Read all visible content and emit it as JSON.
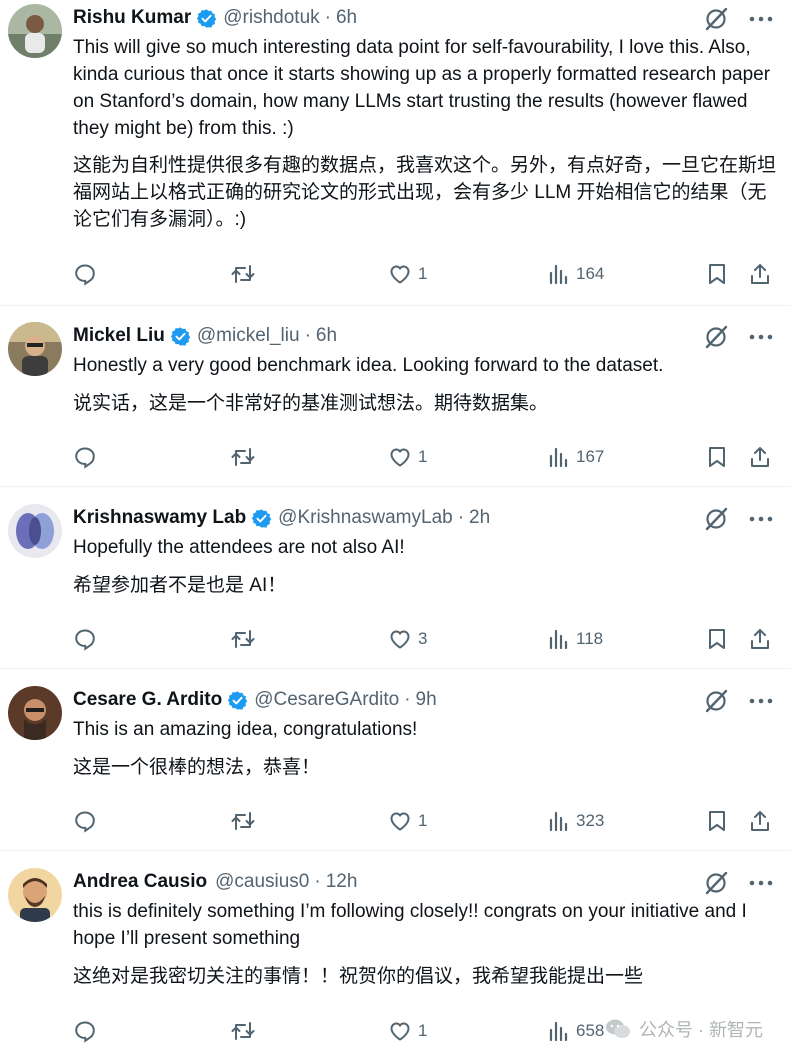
{
  "tweets": [
    {
      "name": "Rishu Kumar",
      "handle": "@rishdotuk",
      "time": "6h",
      "text_en": "This will give so much interesting data point for self-favourability, I love this. Also, kinda curious that once it starts showing up as a properly formatted research paper on Stanford’s domain, how many LLMs start trusting the results (however flawed they might be) from this. :)",
      "text_zh": "这能为自利性提供很多有趣的数据点，我喜欢这个。另外，有点好奇，一旦它在斯坦福网站上以格式正确的研究论文的形式出现，会有多少 LLM 开始相信它的结果（无论它们有多漏洞）。:)",
      "likes": "1",
      "views": "164"
    },
    {
      "name": "Mickel Liu",
      "handle": "@mickel_liu",
      "time": "6h",
      "text_en": "Honestly a very good benchmark idea. Looking forward to the dataset.",
      "text_zh": "说实话，这是一个非常好的基准测试想法。期待数据集。",
      "likes": "1",
      "views": "167"
    },
    {
      "name": "Krishnaswamy Lab",
      "handle": "@KrishnaswamyLab",
      "time": "2h",
      "text_en": "Hopefully the attendees are not also AI!",
      "text_zh": "希望参加者不是也是 AI！",
      "likes": "3",
      "views": "118"
    },
    {
      "name": "Cesare G. Ardito",
      "handle": "@CesareGArdito",
      "time": "9h",
      "text_en": "This is an amazing idea, congratulations!",
      "text_zh": "这是一个很棒的想法，恭喜！",
      "likes": "1",
      "views": "323"
    },
    {
      "name": "Andrea Causio",
      "handle": "@causius0",
      "time": "12h",
      "text_en": "this is definitely something I’m following closely!! congrats on your initiative and I hope I’ll present something",
      "text_zh": "这绝对是我密切关注的事情！！祝贺你的倡议，我希望我能提出一些",
      "likes": "1",
      "views": "658"
    }
  ],
  "separator_dot": "·",
  "watermark": {
    "text": "公众号 · 新智元"
  },
  "colors": {
    "text": "#0f1419",
    "secondary": "#536471",
    "verified": "#1d9bf0",
    "divider": "#eff3f4"
  },
  "icons": {
    "reply": "reply-icon",
    "retweet": "retweet-icon",
    "like": "heart-icon",
    "views": "views-icon",
    "bookmark": "bookmark-icon",
    "share": "share-icon",
    "grok": "grok-icon",
    "more": "more-icon",
    "verified": "verified-badge-icon"
  }
}
